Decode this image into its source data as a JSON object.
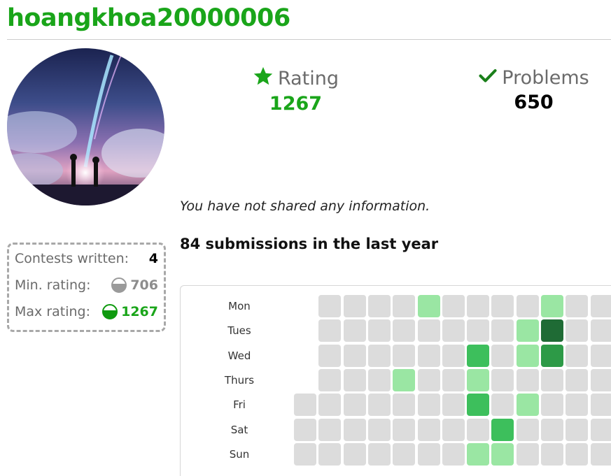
{
  "profile": {
    "username": "hoangkhoa20000006",
    "avatar_alt": "avatar",
    "info_text": "You have not shared any information."
  },
  "stats": {
    "rating_label": "Rating",
    "rating_value": "1267",
    "rating_icon": "star-icon",
    "problems_label": "Problems",
    "problems_value": "650",
    "problems_icon": "check-icon"
  },
  "contests": {
    "written_label": "Contests written:",
    "written_value": "4",
    "min_label": "Min. rating:",
    "min_value": "706",
    "max_label": "Max rating:",
    "max_value": "1267"
  },
  "submissions": {
    "title": "84 submissions in the last year",
    "days": [
      "Mon",
      "Tues",
      "Wed",
      "Thurs",
      "Fri",
      "Sat",
      "Sun"
    ],
    "levels": [
      [
        null,
        0,
        0,
        0,
        0,
        1,
        0,
        0,
        0,
        0,
        1,
        0,
        0
      ],
      [
        null,
        0,
        0,
        0,
        0,
        0,
        0,
        0,
        0,
        1,
        4,
        0,
        0
      ],
      [
        null,
        0,
        0,
        0,
        0,
        0,
        0,
        2,
        0,
        1,
        3,
        0,
        0
      ],
      [
        null,
        0,
        0,
        0,
        1,
        0,
        0,
        1,
        0,
        0,
        0,
        0,
        0
      ],
      [
        0,
        0,
        0,
        0,
        0,
        0,
        0,
        2,
        0,
        1,
        0,
        0,
        0
      ],
      [
        0,
        0,
        0,
        0,
        0,
        0,
        0,
        0,
        2,
        0,
        0,
        0,
        0
      ],
      [
        0,
        0,
        0,
        0,
        0,
        0,
        0,
        1,
        1,
        0,
        0,
        0,
        0
      ]
    ]
  },
  "colors": {
    "accent_green": "#1aa51a",
    "empty_cell": "#dcdcdc",
    "level1": "#9ae6a3",
    "level2": "#3dbf5c",
    "level3": "#2d9a47",
    "level4": "#1f6b35"
  }
}
